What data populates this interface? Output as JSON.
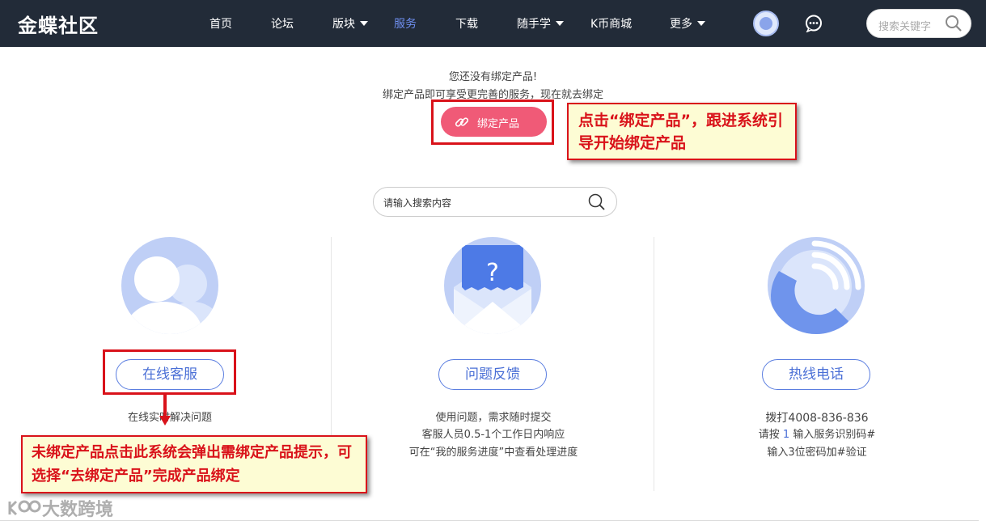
{
  "header": {
    "logo": "金蝶社区",
    "nav": [
      {
        "label": "首页"
      },
      {
        "label": "论坛"
      },
      {
        "label": "版块"
      },
      {
        "label": "服务"
      },
      {
        "label": "下载"
      },
      {
        "label": "随手学"
      },
      {
        "label": "K币商城"
      },
      {
        "label": "更多"
      }
    ],
    "search_placeholder": "搜索关键字"
  },
  "bind_section": {
    "message_line1": "您还没有绑定产品!",
    "message_line2": "绑定产品即可享受更完善的服务，现在就去绑定",
    "button_label": "绑定产品"
  },
  "annotations": {
    "callout_top": "点击“绑定产品”，跟进系统引导开始绑定产品",
    "callout_bottom": "未绑定产品点击此系统会弹出需绑定产品提示，可选择“去绑定产品”完成产品绑定"
  },
  "main_search": {
    "placeholder": "请输入搜索内容"
  },
  "services": [
    {
      "button": "在线客服",
      "desc": [
        "在线实时解决问题"
      ]
    },
    {
      "button": "问题反馈",
      "desc": [
        "使用问题，需求随时提交",
        "客服人员0.5-1个工作日内响应",
        "可在“我的服务进度”中查看处理进度"
      ]
    },
    {
      "button": "热线电话",
      "desc_phone": "拨打4008-836-836",
      "desc_prefix": "请按 ",
      "desc_key": "1",
      "desc_suffix": " 输入服务识别码#",
      "desc_last": "输入3位密码加#验证"
    }
  ],
  "watermark": "大数跨境",
  "colors": {
    "nav_bg": "#222b38",
    "active_nav": "#6f8ff0",
    "bind_button": "#f05a77",
    "accent_blue": "#4a6fd6",
    "annotation_red": "#d9121a",
    "callout_bg": "#fdfcd4"
  }
}
